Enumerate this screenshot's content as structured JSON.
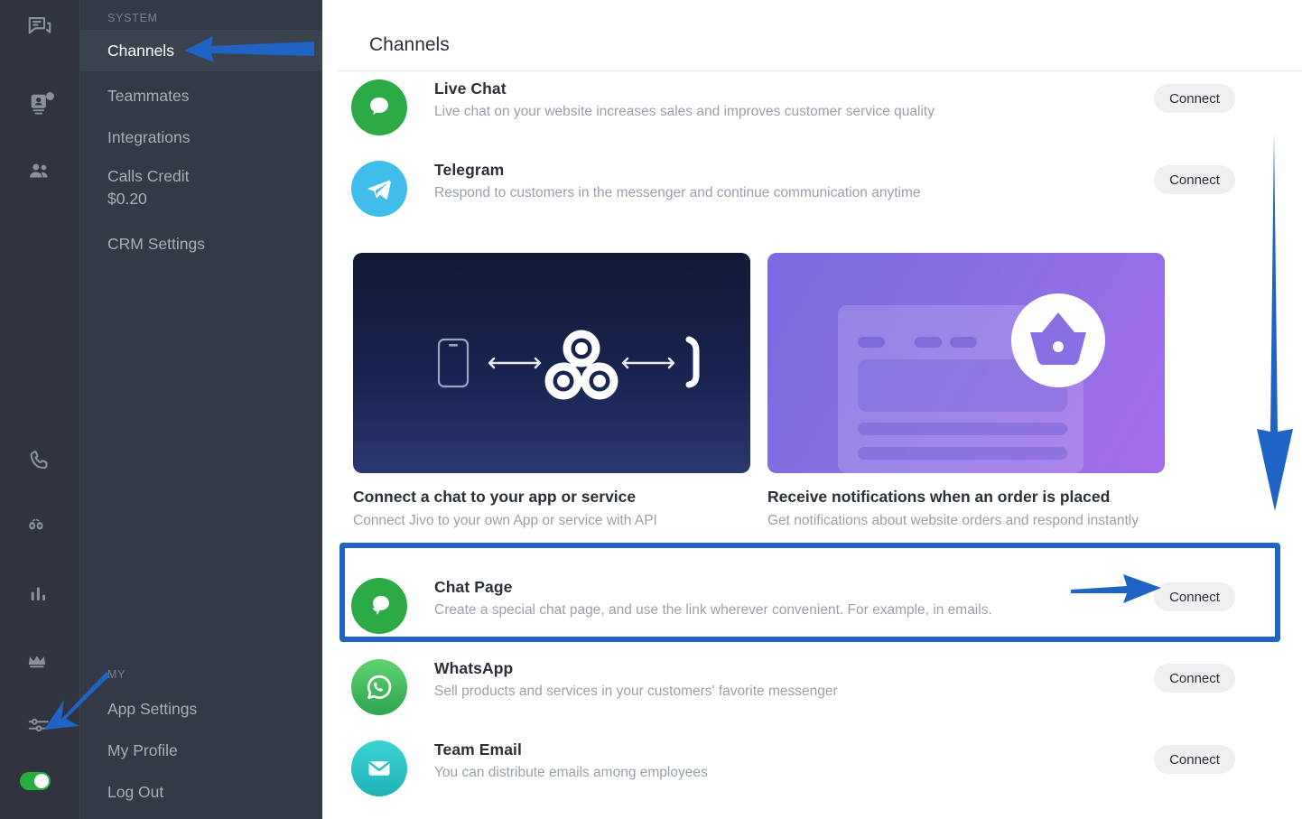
{
  "rail": {
    "icons": [
      {
        "name": "chats-icon",
        "label": "Chats"
      },
      {
        "name": "contacts-icon",
        "label": "Contacts"
      },
      {
        "name": "teammates-icon",
        "label": "Teammates"
      },
      {
        "name": "calls-icon",
        "label": "Calls"
      },
      {
        "name": "visitors-icon",
        "label": "Visitors"
      },
      {
        "name": "statistics-icon",
        "label": "Statistics"
      },
      {
        "name": "crown-icon",
        "label": "Premium"
      },
      {
        "name": "settings-sliders-icon",
        "label": "Settings"
      }
    ],
    "status_toggle": {
      "name": "online-status-toggle",
      "state": "on",
      "color": "#27ae3f"
    }
  },
  "sidebar": {
    "sections": [
      {
        "label": "SYSTEM",
        "items": [
          {
            "label": "Channels",
            "active": true
          },
          {
            "label": "Teammates",
            "active": false
          },
          {
            "label": "Integrations",
            "active": false
          },
          {
            "label": "Calls Credit",
            "sub": "$0.20",
            "active": false
          },
          {
            "label": "CRM Settings",
            "active": false
          }
        ]
      },
      {
        "label": "MY",
        "items": [
          {
            "label": "App Settings",
            "active": false
          },
          {
            "label": "My Profile",
            "active": false
          },
          {
            "label": "Log Out",
            "active": false
          }
        ]
      }
    ]
  },
  "main": {
    "title": "Channels",
    "connect_label": "Connect",
    "top_channels": [
      {
        "name": "Live Chat",
        "description": "Live chat on your website increases sales and improves customer service quality",
        "icon": "live-chat-icon",
        "icon_color": "#2caa46",
        "connect": "Connect"
      },
      {
        "name": "Telegram",
        "description": "Respond to customers in the messenger and continue communication anytime",
        "icon": "telegram-icon",
        "icon_color": "#41bdeb",
        "connect": "Connect"
      }
    ],
    "promos": [
      {
        "title": "Connect a chat to your app or service",
        "description": "Connect Jivo to your own App or service with API",
        "art": "webhook-art",
        "bg": "#182350"
      },
      {
        "title": "Receive notifications when an order is placed",
        "description": "Get notifications about website orders and respond instantly",
        "art": "order-basket-art",
        "bg": "#8a6fe4"
      }
    ],
    "bottom_channels": [
      {
        "name": "Chat Page",
        "description": "Create a special chat page, and use the link wherever convenient. For example, in emails.",
        "icon": "chat-page-icon",
        "icon_color": "#2caa46",
        "connect": "Connect",
        "highlighted": true
      },
      {
        "name": "WhatsApp",
        "description": "Sell products and services in your customers' favorite messenger",
        "icon": "whatsapp-icon",
        "icon_color": "#4cc161",
        "connect": "Connect",
        "highlighted": false
      },
      {
        "name": "Team Email",
        "description": "You can distribute emails among employees",
        "icon": "team-email-icon",
        "icon_color": "#2ec4c4",
        "connect": "Connect",
        "highlighted": false
      }
    ]
  },
  "annotations": {
    "color": "#1f63c4",
    "items": [
      {
        "name": "arrow-to-channels-nav",
        "direction": "left"
      },
      {
        "name": "arrow-down-right-edge",
        "direction": "down"
      },
      {
        "name": "arrow-to-chat-page-connect",
        "direction": "right"
      },
      {
        "name": "arrow-to-settings-icon",
        "direction": "down-left"
      },
      {
        "name": "highlight-box-chat-page",
        "shape": "rectangle"
      }
    ]
  }
}
